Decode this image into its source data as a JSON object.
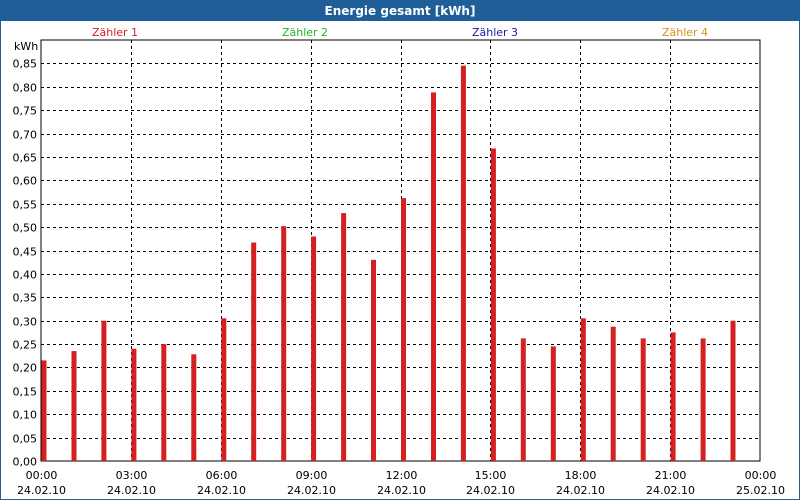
{
  "window": {
    "title": "Energie gesamt [kWh]"
  },
  "legend": [
    {
      "label": "Zähler 1",
      "color": "#d42020"
    },
    {
      "label": "Zähler 2",
      "color": "#22b822"
    },
    {
      "label": "Zähler 3",
      "color": "#1a1aa8"
    },
    {
      "label": "Zähler 4",
      "color": "#d4901a"
    }
  ],
  "chart_data": {
    "type": "bar",
    "title": "Energie gesamt [kWh]",
    "ylabel": "kWh",
    "xlabel": "",
    "ylim": [
      0,
      0.9
    ],
    "grid": true,
    "bar_color": "#d42020",
    "y_ticks": [
      "0,00",
      "0,05",
      "0,10",
      "0,15",
      "0,20",
      "0,25",
      "0,30",
      "0,35",
      "0,40",
      "0,45",
      "0,50",
      "0,55",
      "0,60",
      "0,65",
      "0,70",
      "0,75",
      "0,80",
      "0,85"
    ],
    "x_ticks": [
      {
        "time": "00:00",
        "date": "24.02.10"
      },
      {
        "time": "03:00",
        "date": "24.02.10"
      },
      {
        "time": "06:00",
        "date": "24.02.10"
      },
      {
        "time": "09:00",
        "date": "24.02.10"
      },
      {
        "time": "12:00",
        "date": "24.02.10"
      },
      {
        "time": "15:00",
        "date": "24.02.10"
      },
      {
        "time": "18:00",
        "date": "24.02.10"
      },
      {
        "time": "21:00",
        "date": "24.02.10"
      },
      {
        "time": "00:00",
        "date": "25.02.10"
      }
    ],
    "categories": [
      "00:00",
      "01:00",
      "02:00",
      "03:00",
      "04:00",
      "05:00",
      "06:00",
      "07:00",
      "08:00",
      "09:00",
      "10:00",
      "11:00",
      "12:00",
      "13:00",
      "14:00",
      "15:00",
      "16:00",
      "17:00",
      "18:00",
      "19:00",
      "20:00",
      "21:00",
      "22:00",
      "23:00"
    ],
    "series": [
      {
        "values": [
          0.215,
          0.235,
          0.3,
          0.24,
          0.25,
          0.228,
          0.305,
          0.467,
          0.502,
          0.48,
          0.53,
          0.43,
          0.562,
          0.788,
          0.845,
          0.668,
          0.262,
          0.245,
          0.305,
          0.287,
          0.262,
          0.275,
          0.262,
          0.3
        ]
      }
    ]
  }
}
